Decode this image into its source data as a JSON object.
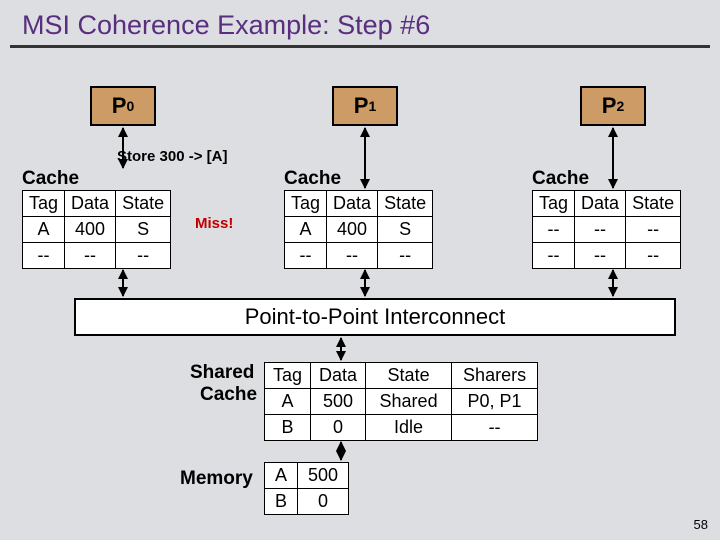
{
  "title": "MSI Coherence Example: Step #6",
  "slide_number": "58",
  "processors": [
    {
      "name": "P",
      "sub": "0"
    },
    {
      "name": "P",
      "sub": "1"
    },
    {
      "name": "P",
      "sub": "2"
    }
  ],
  "annotations": {
    "store": "Store 300 -> [A]",
    "miss": "Miss!"
  },
  "cache_label": "Cache",
  "cache_headers": {
    "tag": "Tag",
    "data": "Data",
    "state": "State"
  },
  "caches": [
    {
      "rows": [
        {
          "tag": "A",
          "data": "400",
          "state": "S"
        },
        {
          "tag": "--",
          "data": "--",
          "state": "--"
        }
      ]
    },
    {
      "rows": [
        {
          "tag": "A",
          "data": "400",
          "state": "S"
        },
        {
          "tag": "--",
          "data": "--",
          "state": "--"
        }
      ]
    },
    {
      "rows": [
        {
          "tag": "--",
          "data": "--",
          "state": "--"
        },
        {
          "tag": "--",
          "data": "--",
          "state": "--"
        }
      ]
    }
  ],
  "interconnect": "Point-to-Point Interconnect",
  "shared_label1": "Shared",
  "shared_label2": "Cache",
  "shared_headers": {
    "tag": "Tag",
    "data": "Data",
    "state": "State",
    "sharers": "Sharers"
  },
  "shared_rows": [
    {
      "tag": "A",
      "data": "500",
      "state": "Shared",
      "sharers": "P0, P1"
    },
    {
      "tag": "B",
      "data": "0",
      "state": "Idle",
      "sharers": "--"
    }
  ],
  "memory_label": "Memory",
  "memory_rows": [
    {
      "tag": "A",
      "data": "500"
    },
    {
      "tag": "B",
      "data": "0"
    }
  ],
  "chart_data": {
    "type": "table",
    "title": "MSI Coherence Example: Step #6",
    "l1_caches": [
      {
        "processor": "P0",
        "entries": [
          {
            "Tag": "A",
            "Data": 400,
            "State": "S"
          },
          {
            "Tag": "--",
            "Data": "--",
            "State": "--"
          }
        ],
        "event": "Store 300 -> [A] (Miss)"
      },
      {
        "processor": "P1",
        "entries": [
          {
            "Tag": "A",
            "Data": 400,
            "State": "S"
          },
          {
            "Tag": "--",
            "Data": "--",
            "State": "--"
          }
        ]
      },
      {
        "processor": "P2",
        "entries": [
          {
            "Tag": "--",
            "Data": "--",
            "State": "--"
          },
          {
            "Tag": "--",
            "Data": "--",
            "State": "--"
          }
        ]
      }
    ],
    "shared_cache": [
      {
        "Tag": "A",
        "Data": 500,
        "State": "Shared",
        "Sharers": "P0, P1"
      },
      {
        "Tag": "B",
        "Data": 0,
        "State": "Idle",
        "Sharers": "--"
      }
    ],
    "memory": [
      {
        "Tag": "A",
        "Data": 500
      },
      {
        "Tag": "B",
        "Data": 0
      }
    ],
    "interconnect": "Point-to-Point Interconnect"
  }
}
